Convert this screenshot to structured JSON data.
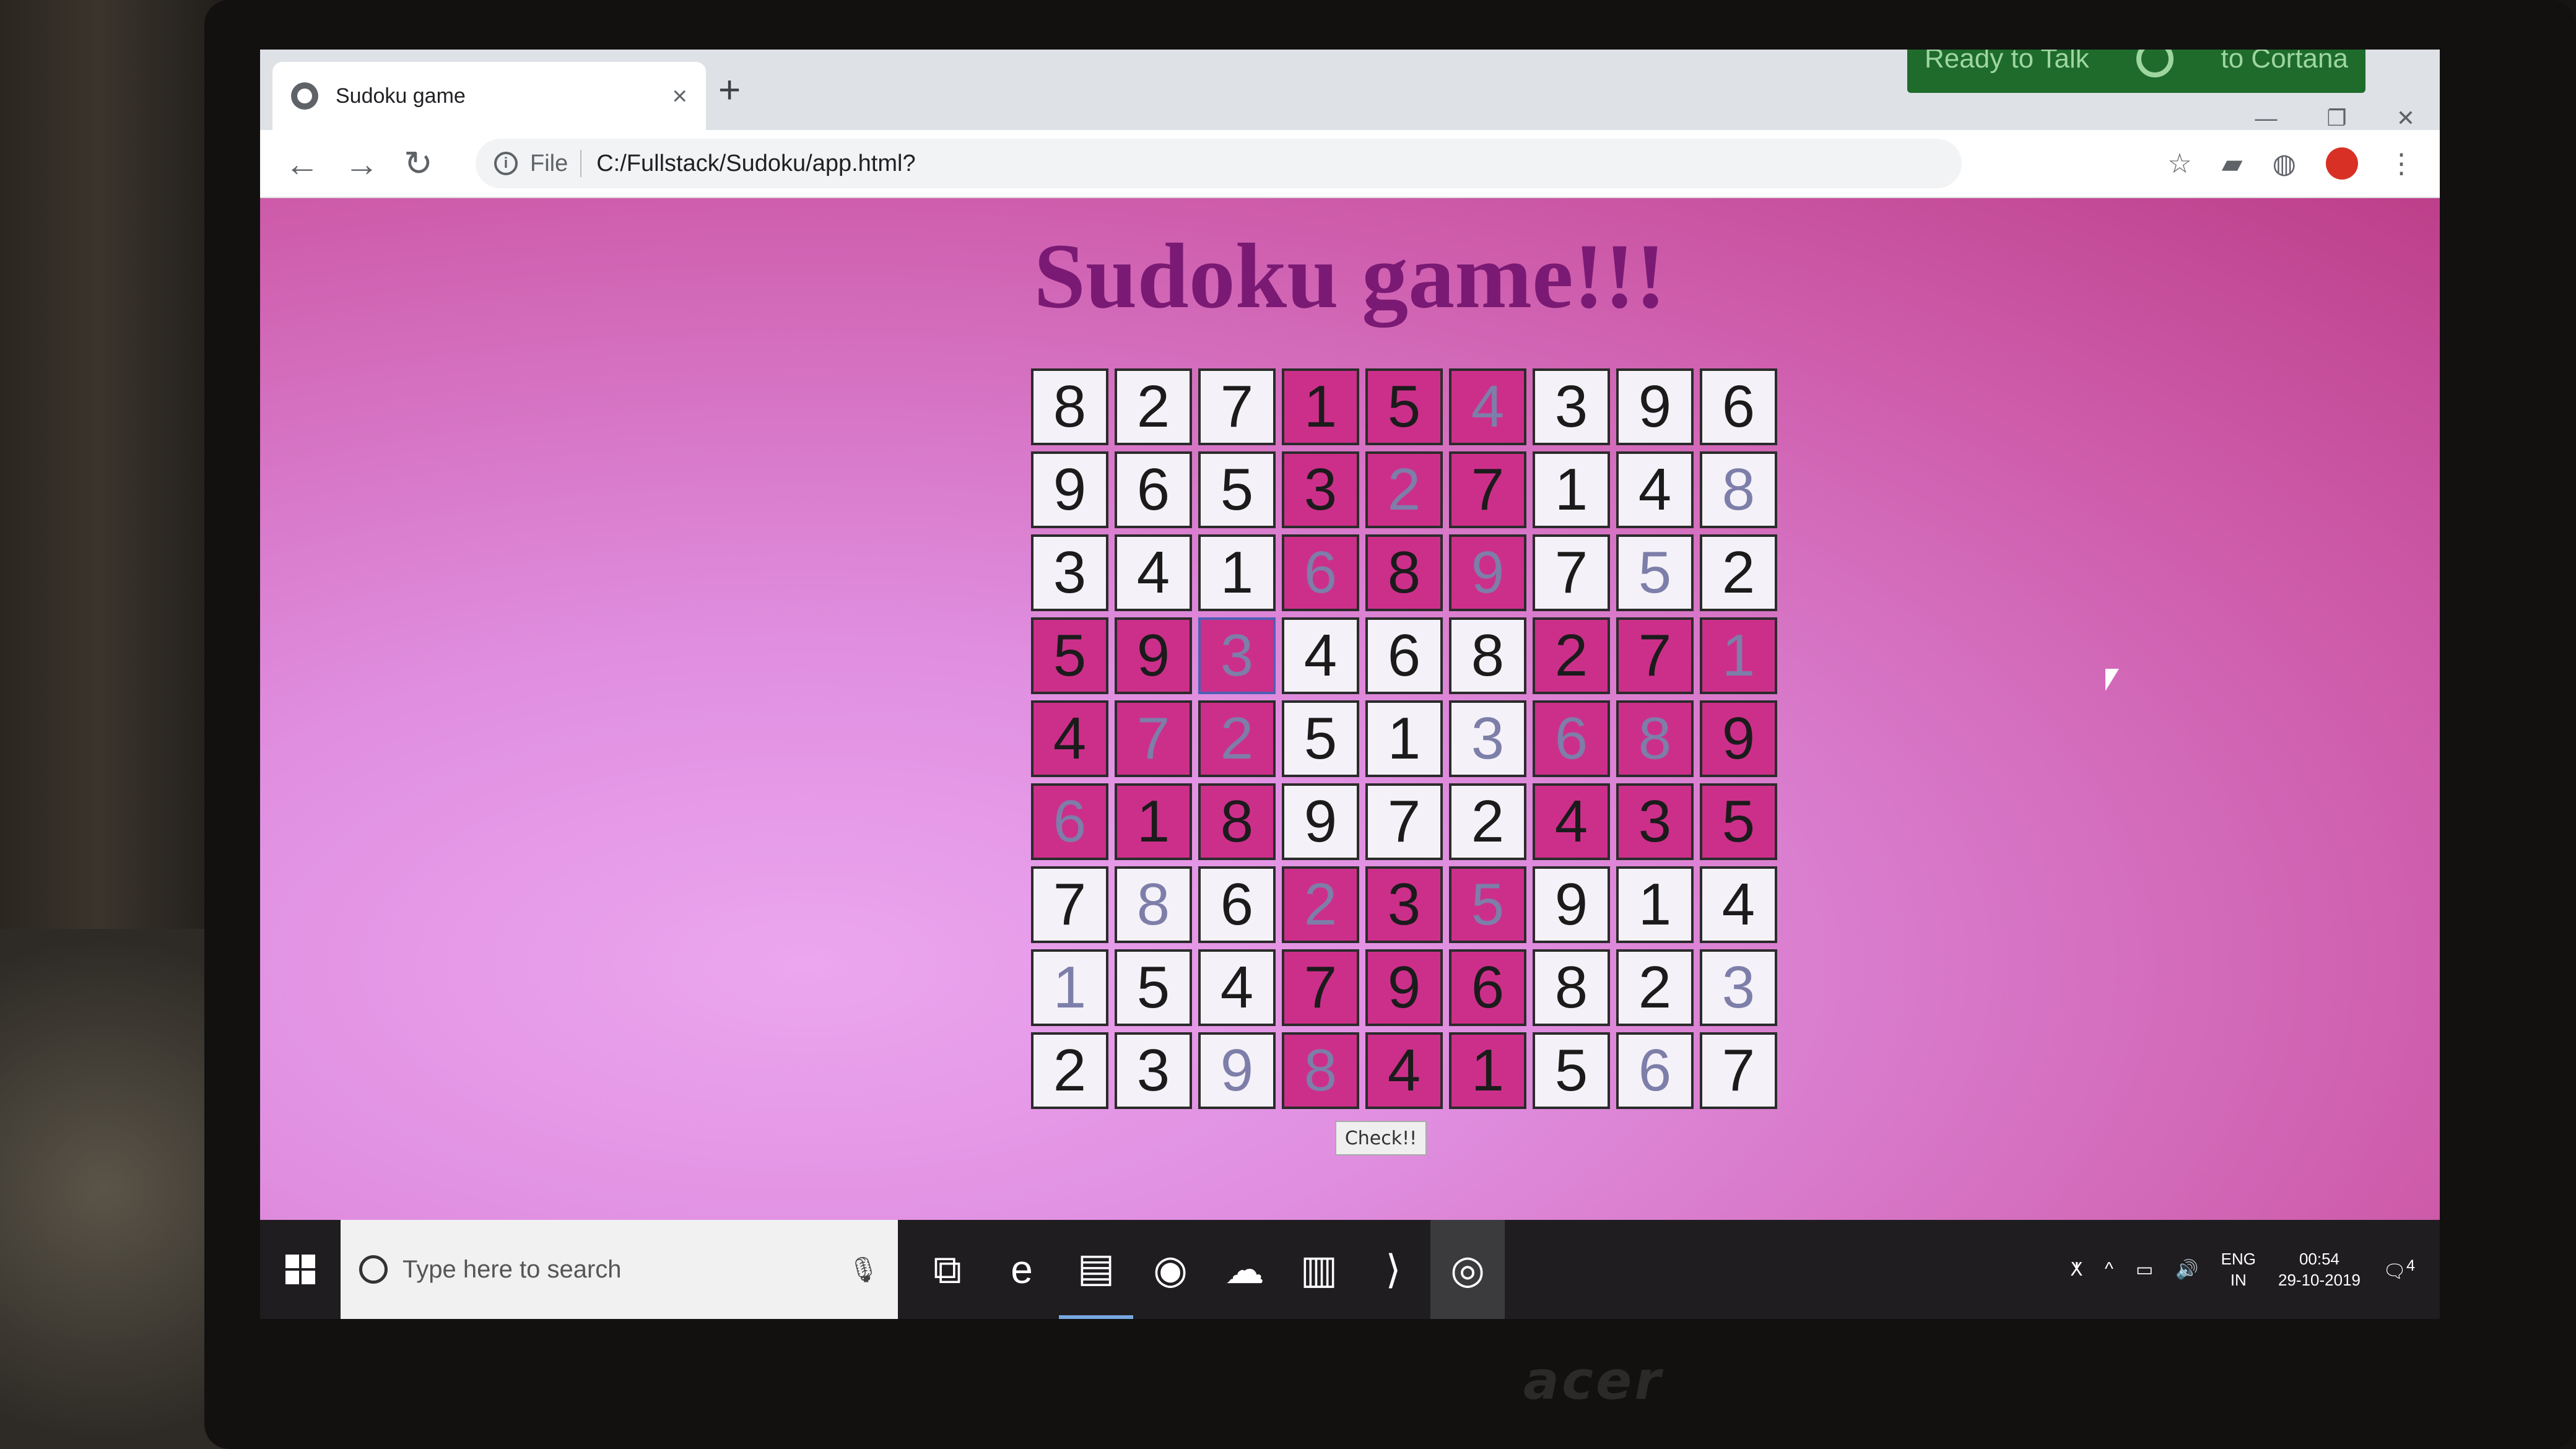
{
  "browser": {
    "tab_title": "Sudoku game",
    "tab_close": "×",
    "new_tab": "+",
    "file_label": "File",
    "url": "C:/Fullstack/Sudoku/app.html?",
    "nav": {
      "back": "←",
      "forward": "→",
      "reload": "↻"
    },
    "window_controls": {
      "minimize": "—",
      "restore": "❐",
      "close": "✕"
    },
    "toolbar_icons": {
      "bookmark": "☆",
      "menu": "⋮"
    }
  },
  "overlay": {
    "cortana": "Ready to Talk",
    "cortana_suffix": "to Cortana"
  },
  "page": {
    "title": "Sudoku game!!!",
    "check_button": "Check!!"
  },
  "board": {
    "rows": [
      [
        "8",
        "2",
        "7",
        "1",
        "5",
        "4",
        "3",
        "9",
        "6"
      ],
      [
        "9",
        "6",
        "5",
        "3",
        "2",
        "7",
        "1",
        "4",
        "8"
      ],
      [
        "3",
        "4",
        "1",
        "6",
        "8",
        "9",
        "7",
        "5",
        "2"
      ],
      [
        "5",
        "9",
        "3",
        "4",
        "6",
        "8",
        "2",
        "7",
        "1"
      ],
      [
        "4",
        "7",
        "2",
        "5",
        "1",
        "3",
        "6",
        "8",
        "9"
      ],
      [
        "6",
        "1",
        "8",
        "9",
        "7",
        "2",
        "4",
        "3",
        "5"
      ],
      [
        "7",
        "8",
        "6",
        "2",
        "3",
        "5",
        "9",
        "1",
        "4"
      ],
      [
        "1",
        "5",
        "4",
        "7",
        "9",
        "6",
        "8",
        "2",
        "3"
      ],
      [
        "2",
        "3",
        "9",
        "8",
        "4",
        "1",
        "5",
        "6",
        "7"
      ]
    ],
    "editable": [
      [
        0,
        0,
        0,
        0,
        0,
        1,
        0,
        0,
        0
      ],
      [
        0,
        0,
        0,
        0,
        1,
        0,
        0,
        0,
        1
      ],
      [
        0,
        0,
        0,
        1,
        0,
        1,
        0,
        1,
        0
      ],
      [
        0,
        0,
        1,
        0,
        0,
        0,
        0,
        0,
        1
      ],
      [
        0,
        1,
        1,
        0,
        0,
        1,
        1,
        1,
        0
      ],
      [
        1,
        0,
        0,
        0,
        0,
        0,
        0,
        0,
        0
      ],
      [
        0,
        1,
        0,
        1,
        0,
        1,
        0,
        0,
        0
      ],
      [
        1,
        0,
        0,
        0,
        0,
        0,
        0,
        0,
        1
      ],
      [
        0,
        0,
        1,
        1,
        0,
        0,
        0,
        1,
        0
      ]
    ],
    "focused_cell": "r3c2",
    "colors": {
      "light": "#f4f2f8",
      "dark": "#cc2f8a",
      "editable_text": "#7d7ea9"
    }
  },
  "taskbar": {
    "search_placeholder": "Type here to search",
    "apps": [
      {
        "name": "task-view-icon",
        "glyph": "⧉"
      },
      {
        "name": "edge-icon",
        "glyph": "e"
      },
      {
        "name": "file-explorer-icon",
        "glyph": "▤"
      },
      {
        "name": "firefox-icon",
        "glyph": "◉"
      },
      {
        "name": "weather-icon",
        "glyph": "☁"
      },
      {
        "name": "notes-icon",
        "glyph": "▥"
      },
      {
        "name": "vscode-icon",
        "glyph": "⟩"
      },
      {
        "name": "chrome-icon",
        "glyph": "◎"
      }
    ],
    "tray": {
      "lang": "ENG",
      "region": "IN",
      "time": "00:54",
      "date": "29-10-2019",
      "notifications": "4"
    }
  }
}
